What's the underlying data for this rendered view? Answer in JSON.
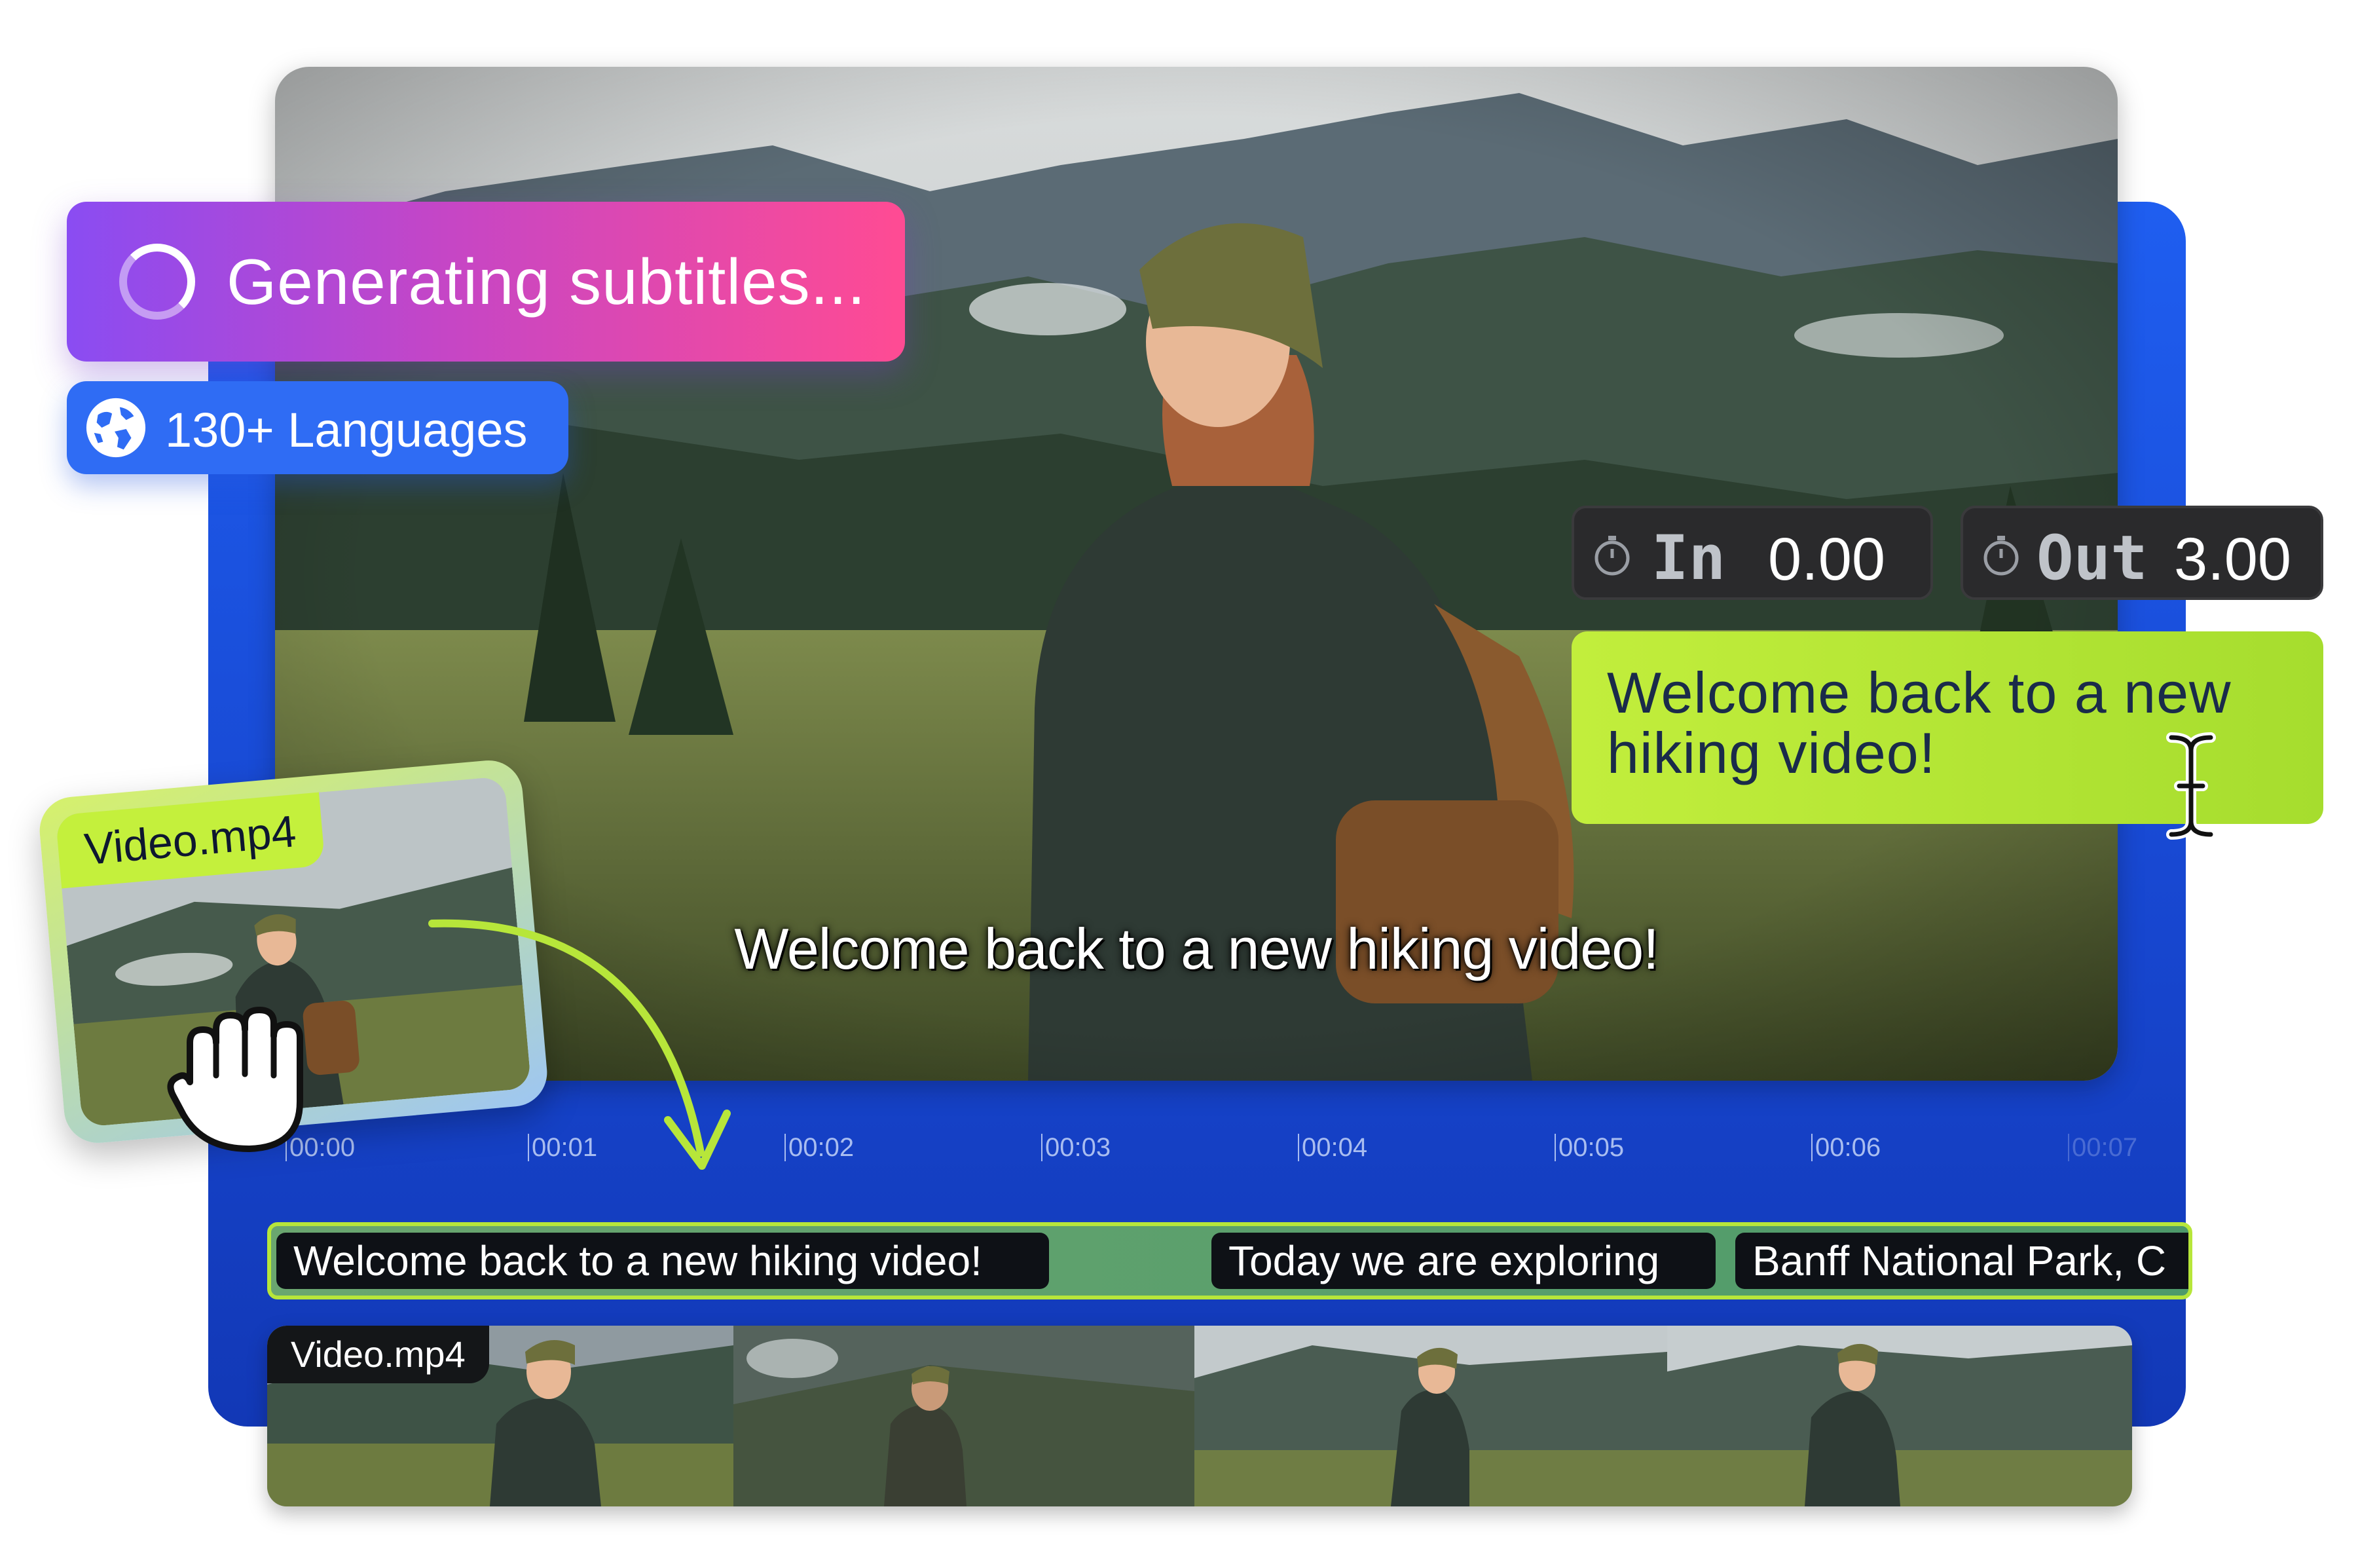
{
  "status_pill": {
    "label": "Generating subtitles...",
    "icon": "spinner-icon"
  },
  "languages_pill": {
    "label": "130+ Languages",
    "icon": "globe-icon"
  },
  "video": {
    "caption": "Welcome back to a new hiking video!"
  },
  "timing": {
    "in_label": "In",
    "in_value": "0.00",
    "out_label": "Out",
    "out_value": "3.00",
    "icon": "stopwatch-icon"
  },
  "editor": {
    "text": "Welcome back to a new hiking video!",
    "cursor_icon": "text-cursor-icon"
  },
  "ruler": {
    "ticks": [
      "00:00",
      "00:01",
      "00:02",
      "00:03",
      "00:04",
      "00:05",
      "00:06",
      "00:07"
    ]
  },
  "subtitle_track": {
    "segments": [
      "Welcome back to a new hiking video!",
      "Today we are exploring",
      "Banff National Park, C"
    ]
  },
  "filmstrip": {
    "label": "Video.mp4"
  },
  "file_card": {
    "label": "Video.mp4",
    "icon": "grab-hand-icon"
  },
  "colors": {
    "panel_blue": "#1f5ef0",
    "gradient_start": "#8a4cf2",
    "gradient_end": "#ff4b93",
    "lime": "#c2ee3c",
    "dark_box": "#2a2a2c"
  }
}
